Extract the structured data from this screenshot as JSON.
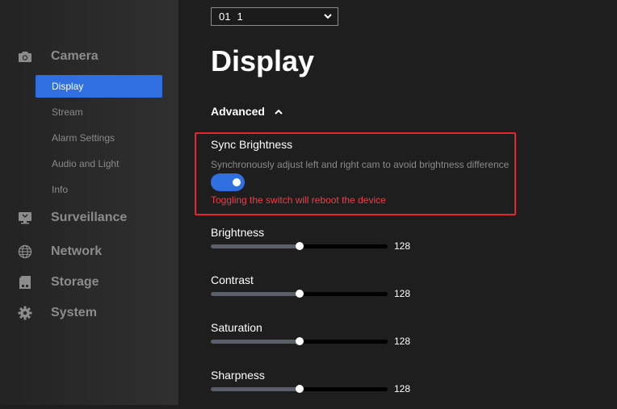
{
  "sidebar": {
    "groups": [
      {
        "label": "Camera",
        "icon": "camera-icon"
      },
      {
        "label": "Surveillance",
        "icon": "monitor-icon"
      },
      {
        "label": "Network",
        "icon": "globe-icon"
      },
      {
        "label": "Storage",
        "icon": "storage-icon"
      },
      {
        "label": "System",
        "icon": "gear-icon"
      }
    ],
    "camera_items": [
      {
        "label": "Display",
        "active": true
      },
      {
        "label": "Stream"
      },
      {
        "label": "Alarm Settings"
      },
      {
        "label": "Audio and Light"
      },
      {
        "label": "Info"
      }
    ]
  },
  "channel_select": {
    "channel": "01",
    "value": "1"
  },
  "page_title": "Display",
  "advanced_label": "Advanced",
  "sync": {
    "title": "Sync Brightness",
    "description": "Synchronously adjust left and right cam to avoid brightness difference",
    "enabled": true,
    "warning": "Toggling the switch will reboot the device"
  },
  "sliders": [
    {
      "label": "Brightness",
      "value": 128,
      "max": 255
    },
    {
      "label": "Contrast",
      "value": 128,
      "max": 255
    },
    {
      "label": "Saturation",
      "value": 128,
      "max": 255
    },
    {
      "label": "Sharpness",
      "value": 128,
      "max": 255
    }
  ],
  "colors": {
    "accent": "#2f6fe0",
    "highlight_border": "#e5252a",
    "warning": "#e8404a"
  }
}
